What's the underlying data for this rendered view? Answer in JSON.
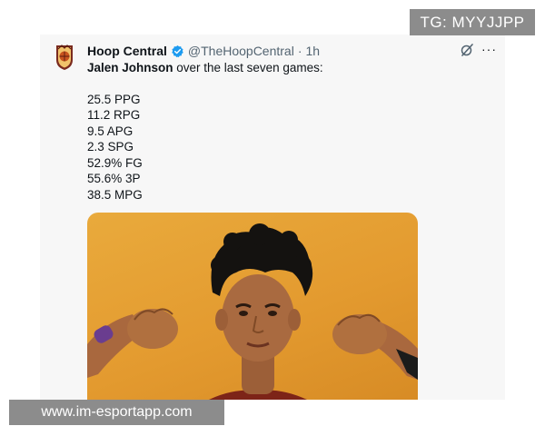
{
  "tweet": {
    "display_name": "Hoop Central",
    "handle": "@TheHoopCentral",
    "separator": "·",
    "time": "1h",
    "intro_name": "Jalen Johnson",
    "intro_rest": " over the last seven games:",
    "stats": [
      "25.5 PPG",
      "11.2 RPG",
      "9.5 APG",
      "2.3 SPG",
      "52.9% FG",
      "55.6% 3P",
      "38.5 MPG"
    ],
    "more_glyph": "···"
  },
  "icons": {
    "avatar": "hoop-central-logo-icon",
    "verified": "verified-badge-icon",
    "grok": "grok-icon",
    "more": "more-options-icon"
  },
  "colors": {
    "card_background": "#f7f7f7",
    "verified_blue": "#1d9bf0",
    "media_background": "#e39a2f",
    "watermark_background": "#8c8c8c"
  },
  "watermarks": {
    "top_right": "TG: MYYJJPP",
    "bottom_left": "www.im-esportapp.com"
  }
}
